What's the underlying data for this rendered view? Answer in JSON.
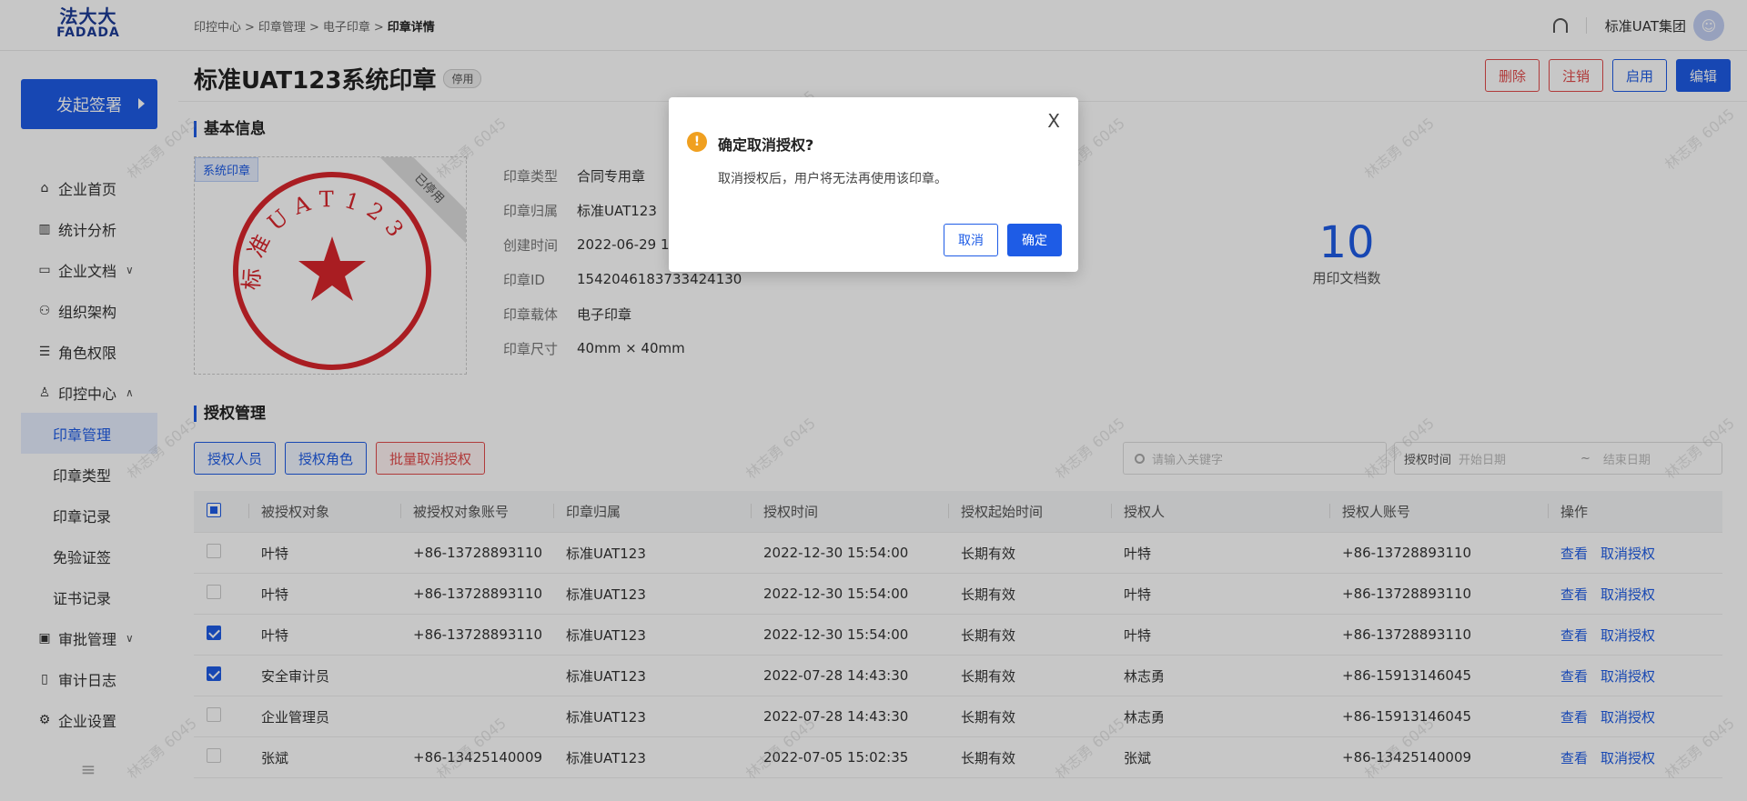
{
  "logo": {
    "line1": "法大大",
    "line2": "FADADA"
  },
  "breadcrumb": [
    "印控中心",
    "印章管理",
    "电子印章",
    "印章详情"
  ],
  "breadcrumb_sep": ">",
  "header": {
    "org_name": "标准UAT集团"
  },
  "sidebar": {
    "start_button": "发起签署",
    "items": [
      {
        "label": "企业首页",
        "icon": "home-icon"
      },
      {
        "label": "统计分析",
        "icon": "chart-icon"
      },
      {
        "label": "企业文档",
        "icon": "folder-icon",
        "expand": "collapsed"
      },
      {
        "label": "组织架构",
        "icon": "org-icon"
      },
      {
        "label": "角色权限",
        "icon": "role-icon"
      },
      {
        "label": "印控中心",
        "icon": "stamp-icon",
        "expand": "expanded"
      },
      {
        "label": "印章管理",
        "sub": true,
        "active": true
      },
      {
        "label": "印章类型",
        "sub": true
      },
      {
        "label": "印章记录",
        "sub": true
      },
      {
        "label": "免验证签",
        "sub": true
      },
      {
        "label": "证书记录",
        "sub": true
      },
      {
        "label": "审批管理",
        "icon": "approve-icon",
        "expand": "collapsed"
      },
      {
        "label": "审计日志",
        "icon": "log-icon"
      },
      {
        "label": "企业设置",
        "icon": "settings-icon"
      }
    ]
  },
  "page": {
    "title": "标准UAT123系统印章",
    "status": "停用",
    "actions": {
      "delete": "删除",
      "cancel": "注销",
      "enable": "启用",
      "edit": "编辑"
    }
  },
  "basic_info": {
    "section_title": "基本信息",
    "seal_tag": "系统印章",
    "ribbon": "已停用",
    "seal_text": "标准UAT123",
    "fields": [
      {
        "k": "印章类型",
        "v": "合同专用章"
      },
      {
        "k": "印章归属",
        "v": "标准UAT123"
      },
      {
        "k": "创建时间",
        "v": "2022-06-29 15"
      },
      {
        "k": "印章ID",
        "v": "1542046183733424130"
      },
      {
        "k": "印章载体",
        "v": "电子印章"
      },
      {
        "k": "印章尺寸",
        "v": "40mm × 40mm"
      }
    ],
    "stat_value": "10",
    "stat_label": "用印文档数"
  },
  "auth": {
    "section_title": "授权管理",
    "btn_persons": "授权人员",
    "btn_roles": "授权角色",
    "btn_batch_cancel": "批量取消授权",
    "search_placeholder": "请输入关键字",
    "date_label": "授权时间",
    "date_start": "开始日期",
    "date_sep": "~",
    "date_end": "结束日期",
    "columns": [
      "被授权对象",
      "被授权对象账号",
      "印章归属",
      "授权时间",
      "授权起始时间",
      "授权人",
      "授权人账号",
      "操作"
    ],
    "rows": [
      {
        "checked": false,
        "cells": [
          "叶特",
          "+86-13728893110",
          "标准UAT123",
          "2022-12-30 15:54:00",
          "长期有效",
          "叶特",
          "+86-13728893110"
        ]
      },
      {
        "checked": false,
        "cells": [
          "叶特",
          "+86-13728893110",
          "标准UAT123",
          "2022-12-30 15:54:00",
          "长期有效",
          "叶特",
          "+86-13728893110"
        ]
      },
      {
        "checked": true,
        "cells": [
          "叶特",
          "+86-13728893110",
          "标准UAT123",
          "2022-12-30 15:54:00",
          "长期有效",
          "叶特",
          "+86-13728893110"
        ]
      },
      {
        "checked": true,
        "cells": [
          "安全审计员",
          "",
          "标准UAT123",
          "2022-07-28 14:43:30",
          "长期有效",
          "林志勇",
          "+86-15913146045"
        ]
      },
      {
        "checked": false,
        "cells": [
          "企业管理员",
          "",
          "标准UAT123",
          "2022-07-28 14:43:30",
          "长期有效",
          "林志勇",
          "+86-15913146045"
        ]
      },
      {
        "checked": false,
        "cells": [
          "张斌",
          "+86-13425140009",
          "标准UAT123",
          "2022-07-05 15:02:35",
          "长期有效",
          "张斌",
          "+86-13425140009"
        ]
      }
    ],
    "op_view": "查看",
    "op_cancel": "取消授权"
  },
  "modal": {
    "title": "确定取消授权?",
    "body": "取消授权后，用户将无法再使用该印章。",
    "cancel": "取消",
    "ok": "确定",
    "close": "X"
  },
  "watermark": "林志勇 6045",
  "colors": {
    "primary": "#1e5ce6",
    "danger": "#e24b4b",
    "seal": "#d9262c",
    "warn": "#f0a020"
  }
}
